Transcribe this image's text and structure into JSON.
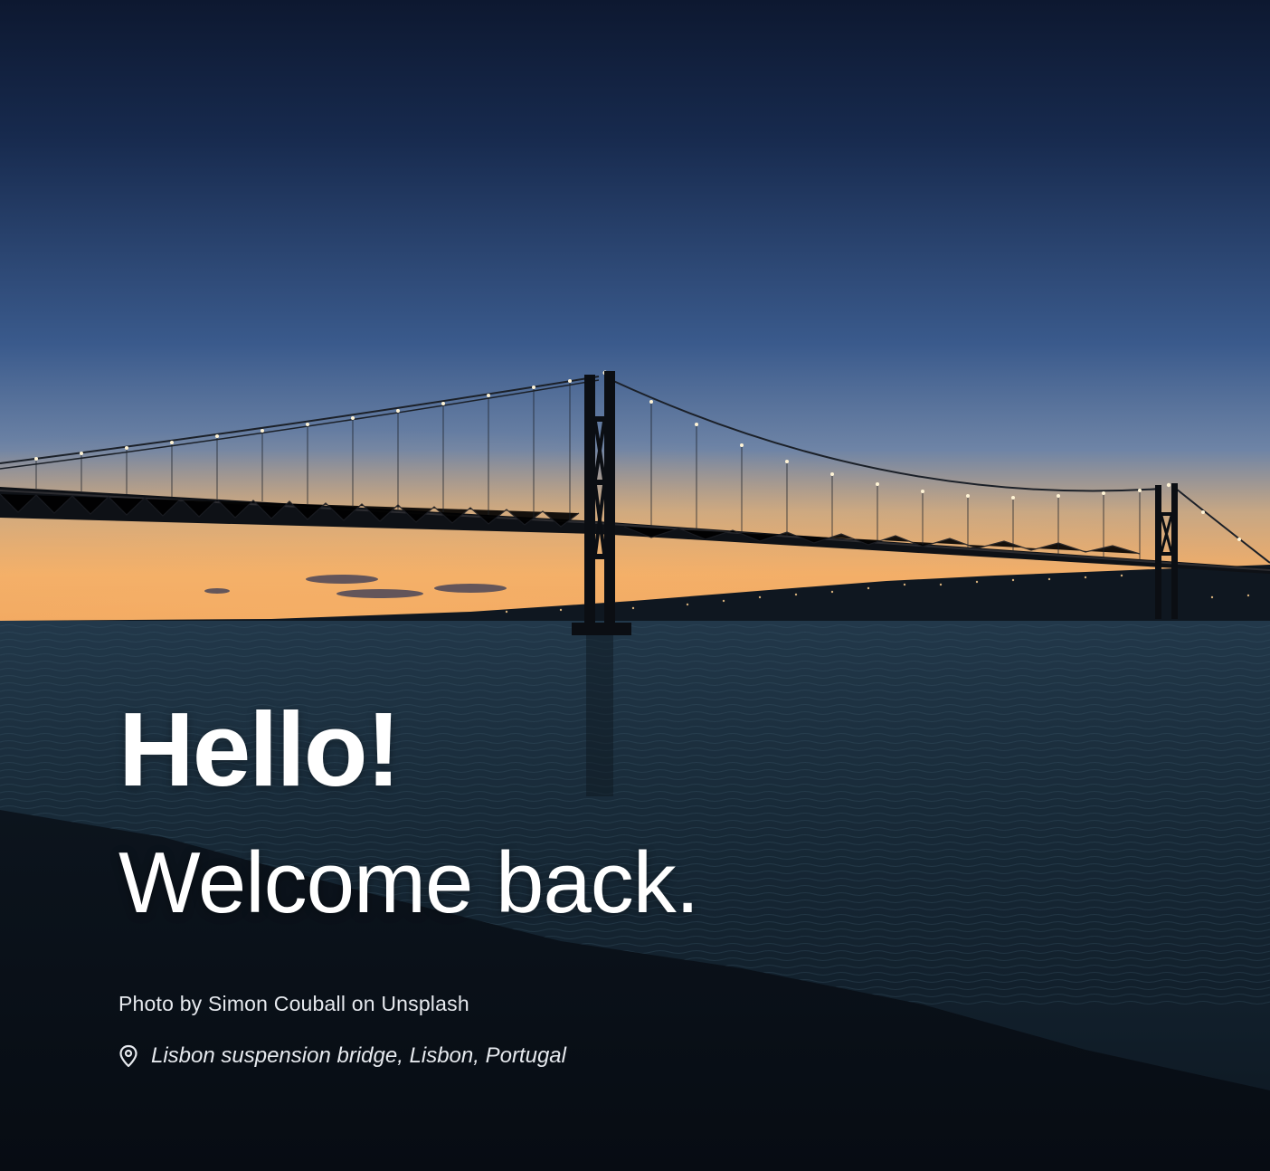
{
  "hero": {
    "greeting": "Hello!",
    "subtitle": "Welcome back.",
    "photo_credit": "Photo by Simon Couball on Unsplash",
    "location_icon": "map-pin-icon",
    "location": "Lisbon suspension bridge, Lisbon, Portugal"
  },
  "colors": {
    "sky_top": "#0e1a33",
    "sky_mid": "#2b4a78",
    "horizon_glow": "#f2b06b",
    "water": "#152633",
    "text": "#ffffff"
  }
}
